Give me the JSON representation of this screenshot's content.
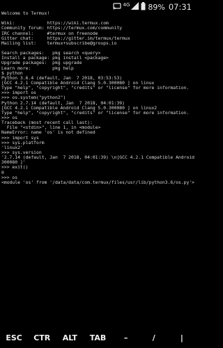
{
  "status_bar": {
    "network_label": "4G",
    "battery_percent": "89%",
    "clock": "07:31",
    "icons": [
      "cast-icon",
      "network-4g-icon",
      "signal-icon",
      "battery-icon"
    ]
  },
  "terminal": {
    "lines": [
      "Welcome to Termux!",
      "",
      "Wiki:            https://wiki.termux.com",
      "Community forum: https://termux.com/community",
      "IRC channel:     #termux on freenode",
      "Gitter chat:     https://gitter.im/termux/termux",
      "Mailing list:    termux+subscribe@groups.io",
      "",
      "Search packages:   pkg search <query>",
      "Install a package: pkg install <package>",
      "Upgrade packages:  pkg upgrade",
      "Learn more:        pkg help",
      "$ python",
      "Python 3.6.4 (default, Jan  7 2018, 03:53:53)",
      "[GCC 4.2.1 Compatible Android Clang 5.0.300080 ] on linux",
      "Type \"help\", \"copyright\", \"credits\" or \"license\" for more information.",
      ">>> import os",
      ">>> os.system(\"python2\")",
      "Python 2.7.14 (default, Jan  7 2018, 04:01:39)",
      "[GCC 4.2.1 Compatible Android Clang 5.0.300080 ] on linux2",
      "Type \"help\", \"copyright\", \"credits\" or \"license\" for more information.",
      ">>> os",
      "Traceback (most recent call last):",
      "  File \"<stdin>\", line 1, in <module>",
      "NameError: name 'os' is not defined",
      ">>> import sys",
      ">>> sys.platform",
      "'linux2'",
      ">>> sys.version",
      "'2.7.14 (default, Jan  7 2018, 04:01:39) \\n[GCC 4.2.1 Compatible Android Clang 5.0.",
      "300080 ]'",
      ">>> exit()",
      "0",
      ">>> os",
      "<module 'os' from '/data/data/com.termux/files/usr/lib/python3.6/os.py'>",
      ">>> "
    ]
  },
  "extra_keys": {
    "esc": "ESC",
    "ctrl": "CTR",
    "alt": "ALT",
    "tab": "TAB",
    "dash": "–",
    "slash": "/",
    "pipe": "|"
  }
}
